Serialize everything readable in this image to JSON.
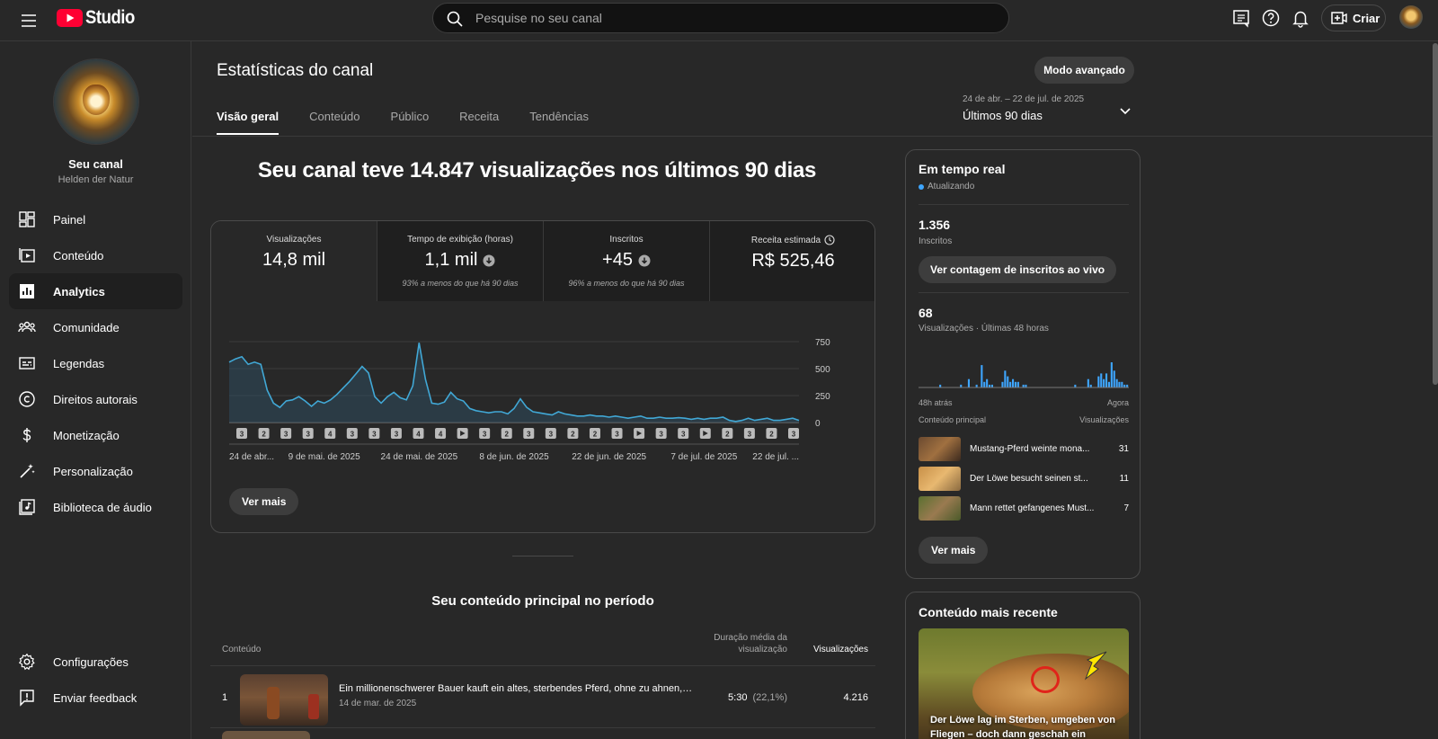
{
  "header": {
    "logo_text": "Studio",
    "search_placeholder": "Pesquise no seu canal",
    "create_label": "Criar",
    "icons": [
      "menu-icon",
      "youtube-logo-icon",
      "search-icon",
      "comments-icon",
      "help-icon",
      "notifications-icon",
      "create-video-icon",
      "account-avatar"
    ]
  },
  "sidebar": {
    "channel_label": "Seu canal",
    "channel_name": "Helden der Natur",
    "items": [
      {
        "label": "Painel",
        "icon": "dashboard-icon"
      },
      {
        "label": "Conteúdo",
        "icon": "content-icon"
      },
      {
        "label": "Analytics",
        "icon": "analytics-icon"
      },
      {
        "label": "Comunidade",
        "icon": "community-icon"
      },
      {
        "label": "Legendas",
        "icon": "subtitles-icon"
      },
      {
        "label": "Direitos autorais",
        "icon": "copyright-icon"
      },
      {
        "label": "Monetização",
        "icon": "monetization-icon"
      },
      {
        "label": "Personalização",
        "icon": "customization-icon"
      },
      {
        "label": "Biblioteca de áudio",
        "icon": "audio-library-icon"
      }
    ],
    "footer": [
      {
        "label": "Configurações",
        "icon": "settings-icon"
      },
      {
        "label": "Enviar feedback",
        "icon": "feedback-icon"
      }
    ]
  },
  "page": {
    "title": "Estatísticas do canal",
    "advanced_button": "Modo avançado",
    "tabs": [
      "Visão geral",
      "Conteúdo",
      "Público",
      "Receita",
      "Tendências"
    ],
    "active_tab": "Visão geral",
    "date_range": "24 de abr. – 22 de jul. de 2025",
    "period_label": "Últimos 90 dias"
  },
  "overview": {
    "headline": "Seu canal teve 14.847 visualizações nos últimos 90 dias",
    "metrics": [
      {
        "label": "Visualizações",
        "value": "14,8 mil",
        "note": ""
      },
      {
        "label": "Tempo de exibição (horas)",
        "value": "1,1 mil",
        "note": "93% a menos do que há 90 dias"
      },
      {
        "label": "Inscritos",
        "value": "+45",
        "note": "96% a menos do que há 90 dias"
      },
      {
        "label": "Receita estimada",
        "value": "R$ 525,46",
        "note": ""
      }
    ],
    "see_more": "Ver mais"
  },
  "chart_data": {
    "type": "area",
    "title": "",
    "x_tick_labels": [
      "24 de abr...",
      "9 de mai. de 2025",
      "24 de mai. de 2025",
      "8 de jun. de 2025",
      "22 de jun. de 2025",
      "7 de jul. de 2025",
      "22 de jul. ..."
    ],
    "y_tick_labels": [
      "750",
      "500",
      "250",
      "0"
    ],
    "ylim": [
      0,
      750
    ],
    "series": [
      {
        "values": [
          560,
          590,
          610,
          540,
          560,
          540,
          300,
          180,
          140,
          200,
          210,
          240,
          200,
          150,
          200,
          180,
          210,
          260,
          320,
          380,
          450,
          520,
          460,
          240,
          180,
          240,
          280,
          230,
          210,
          340,
          740,
          400,
          180,
          170,
          190,
          280,
          220,
          200,
          130,
          110,
          100,
          90,
          100,
          100,
          80,
          130,
          220,
          140,
          100,
          90,
          80,
          70,
          100,
          80,
          70,
          60,
          60,
          70,
          60,
          60,
          50,
          60,
          50,
          40,
          50,
          60,
          40,
          40,
          50,
          40,
          40,
          45,
          40,
          30,
          40,
          30,
          40,
          40,
          50,
          20,
          10,
          20,
          40,
          20,
          30,
          40,
          20,
          20,
          30,
          40,
          20
        ]
      }
    ],
    "grid": true,
    "legend": "none",
    "upload_markers": [
      "3",
      "2",
      "3",
      "3",
      "4",
      "3",
      "3",
      "3",
      "4",
      "4",
      "play",
      "3",
      "2",
      "3",
      "3",
      "2",
      "2",
      "3",
      "play",
      "3",
      "3",
      "play",
      "2",
      "3",
      "2",
      "3"
    ]
  },
  "top_content": {
    "title": "Seu conteúdo principal no período",
    "col_content": "Conteúdo",
    "col_duration": "Duração média da visualização",
    "col_views": "Visualizações",
    "rows": [
      {
        "rank": "1",
        "title": "Ein millionenschwerer Bauer kauft ein altes, sterbendes Pferd, ohne zu ahnen, we...",
        "date": "14 de mar. de 2025",
        "duration": "5:30",
        "percent": "(22,1%)",
        "views": "4.216"
      }
    ]
  },
  "realtime": {
    "title": "Em tempo real",
    "status": "Atualizando",
    "subscribers_value": "1.356",
    "subscribers_label": "Inscritos",
    "live_count_button": "Ver contagem de inscritos ao vivo",
    "views_value": "68",
    "views_label": "Visualizações · Últimas 48 horas",
    "axis_start": "48h atrás",
    "axis_end": "Agora",
    "bars": [
      0,
      0,
      0,
      0,
      0,
      0,
      0,
      0,
      1,
      0,
      0,
      0,
      0,
      0,
      0,
      0,
      1,
      0,
      0,
      3,
      0,
      0,
      1,
      0,
      8,
      2,
      3,
      1,
      1,
      0,
      0,
      0,
      2,
      6,
      4,
      2,
      3,
      2,
      2,
      0,
      1,
      1,
      0,
      0,
      0,
      0,
      0,
      0,
      0,
      0,
      0,
      0,
      0,
      0,
      0,
      0,
      0,
      0,
      0,
      0,
      1,
      0,
      0,
      0,
      0,
      3,
      1,
      0,
      0,
      4,
      5,
      3,
      5,
      2,
      9,
      6,
      3,
      2,
      2,
      1,
      1
    ],
    "top_content_label": "Conteúdo principal",
    "views_col_label": "Visualizações",
    "items": [
      {
        "title": "Mustang-Pferd weinte mona...",
        "views": "31"
      },
      {
        "title": "Der Löwe besucht seinen st...",
        "views": "11"
      },
      {
        "title": "Mann rettet gefangenes Must...",
        "views": "7"
      }
    ],
    "see_more": "Ver mais"
  },
  "latest": {
    "title": "Conteúdo mais recente",
    "caption": "Der Löwe lag im Sterben, umgeben von Fliegen – doch dann geschah ein Wunder."
  },
  "colors": {
    "background": "#282828",
    "accent_blue": "#3ea6ff",
    "chart_line": "#41a8d6",
    "youtube_red": "#ff0033"
  }
}
